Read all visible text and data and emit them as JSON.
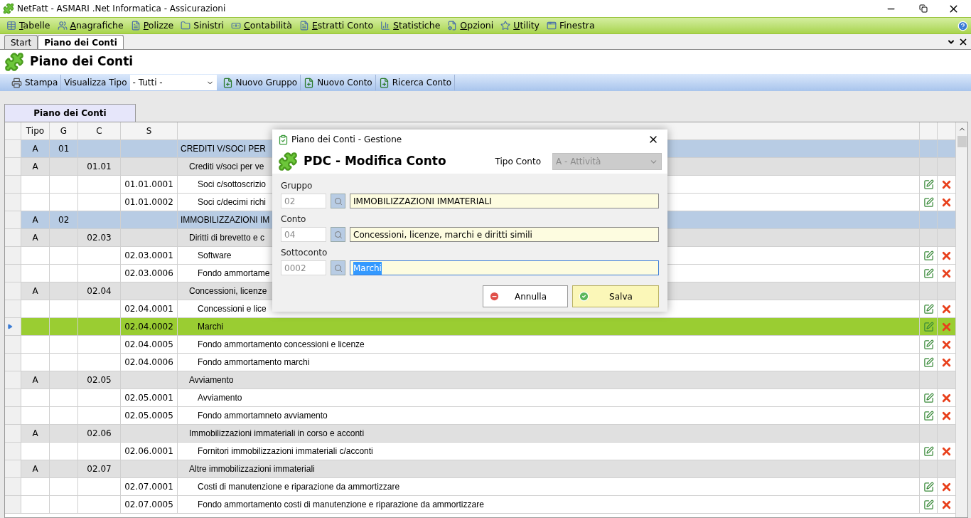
{
  "window": {
    "title": "NetFatt - ASMARI .Net Informatica - Assicurazioni"
  },
  "menu": [
    {
      "label": "Tabelle",
      "accel": true
    },
    {
      "label": "Anagrafiche",
      "accel": true
    },
    {
      "label": "Polizze",
      "accel": true
    },
    {
      "label": "Sinistri",
      "accel": false
    },
    {
      "label": "Contabilità",
      "accel": true
    },
    {
      "label": "Estratti Conto",
      "accel": true
    },
    {
      "label": "Statistiche",
      "accel": true
    },
    {
      "label": "Opzioni",
      "accel": true
    },
    {
      "label": "Utility",
      "accel": true
    },
    {
      "label": "Finestra",
      "accel": false
    }
  ],
  "doc_tabs": [
    {
      "label": "Start",
      "selected": false
    },
    {
      "label": "Piano dei Conti",
      "selected": true
    }
  ],
  "page_title": "Piano dei Conti",
  "toolbar": [
    {
      "kind": "button",
      "label": "Stampa"
    },
    {
      "kind": "label",
      "label": "Visualizza Tipo"
    },
    {
      "kind": "select",
      "label": "- Tutti -"
    },
    {
      "kind": "button",
      "label": "Nuovo Gruppo"
    },
    {
      "kind": "button",
      "label": "Nuovo Conto"
    },
    {
      "kind": "button",
      "label": "Ricerca Conto"
    }
  ],
  "grid": {
    "tab": "Piano dei Conti",
    "columns": [
      "Tipo",
      "G",
      "C",
      "S"
    ],
    "rows": [
      {
        "kind": "group",
        "tipo": "A",
        "g": "01",
        "c": "",
        "s": "",
        "description": "CREDITI V/SOCI PER",
        "selected": false
      },
      {
        "kind": "conto",
        "tipo": "A",
        "g": "",
        "c": "01.01",
        "s": "",
        "description": "Crediti v/soci per ve",
        "selected": false
      },
      {
        "kind": "sub",
        "tipo": "",
        "g": "",
        "c": "",
        "s": "01.01.0001",
        "description": "Soci c/sottoscrizio",
        "selected": false
      },
      {
        "kind": "sub",
        "tipo": "",
        "g": "",
        "c": "",
        "s": "01.01.0002",
        "description": "Soci c/decimi richi",
        "selected": false
      },
      {
        "kind": "group",
        "tipo": "A",
        "g": "02",
        "c": "",
        "s": "",
        "description": "IMMOBILIZZAZIONI IM",
        "selected": false
      },
      {
        "kind": "conto",
        "tipo": "A",
        "g": "",
        "c": "02.03",
        "s": "",
        "description": "Diritti di brevetto e c",
        "selected": false
      },
      {
        "kind": "sub",
        "tipo": "",
        "g": "",
        "c": "",
        "s": "02.03.0001",
        "description": "Software",
        "selected": false
      },
      {
        "kind": "sub",
        "tipo": "",
        "g": "",
        "c": "",
        "s": "02.03.0006",
        "description": "Fondo ammortame",
        "selected": false
      },
      {
        "kind": "conto",
        "tipo": "A",
        "g": "",
        "c": "02.04",
        "s": "",
        "description": "Concessioni, licenze",
        "selected": false
      },
      {
        "kind": "sub",
        "tipo": "",
        "g": "",
        "c": "",
        "s": "02.04.0001",
        "description": "Concessioni e lice",
        "selected": false
      },
      {
        "kind": "sub",
        "tipo": "",
        "g": "",
        "c": "",
        "s": "02.04.0002",
        "description": "Marchi",
        "selected": true
      },
      {
        "kind": "sub",
        "tipo": "",
        "g": "",
        "c": "",
        "s": "02.04.0005",
        "description": "Fondo ammortamento concessioni e licenze",
        "selected": false
      },
      {
        "kind": "sub",
        "tipo": "",
        "g": "",
        "c": "",
        "s": "02.04.0006",
        "description": "Fondo ammortamento marchi",
        "selected": false
      },
      {
        "kind": "conto",
        "tipo": "A",
        "g": "",
        "c": "02.05",
        "s": "",
        "description": "Avviamento",
        "selected": false
      },
      {
        "kind": "sub",
        "tipo": "",
        "g": "",
        "c": "",
        "s": "02.05.0001",
        "description": "Avviamento",
        "selected": false
      },
      {
        "kind": "sub",
        "tipo": "",
        "g": "",
        "c": "",
        "s": "02.05.0005",
        "description": "Fondo ammortamneto avviamento",
        "selected": false
      },
      {
        "kind": "conto",
        "tipo": "A",
        "g": "",
        "c": "02.06",
        "s": "",
        "description": "Immobilizzazioni immateriali in corso e acconti",
        "selected": false
      },
      {
        "kind": "sub",
        "tipo": "",
        "g": "",
        "c": "",
        "s": "02.06.0001",
        "description": "Fornitori immobilizzazioni immateriali c/acconti",
        "selected": false
      },
      {
        "kind": "conto",
        "tipo": "A",
        "g": "",
        "c": "02.07",
        "s": "",
        "description": "Altre immobilizzazioni immateriali",
        "selected": false
      },
      {
        "kind": "sub",
        "tipo": "",
        "g": "",
        "c": "",
        "s": "02.07.0001",
        "description": "Costi di manutenzione e riparazione da ammortizzare",
        "selected": false
      },
      {
        "kind": "sub",
        "tipo": "",
        "g": "",
        "c": "",
        "s": "02.07.0005",
        "description": "Fondo ammortamento costi di manutenzione e riparazione da ammortizzare",
        "selected": false
      }
    ]
  },
  "dialog": {
    "title": "Piano dei Conti - Gestione",
    "heading": "PDC - Modifica Conto",
    "tipo_label": "Tipo Conto",
    "tipo_value": "A - Attività",
    "tipo_disabled": true,
    "fields": [
      {
        "label": "Gruppo",
        "code": "02",
        "value": "IMMOBILIZZAZIONI IMMATERIALI",
        "focused": false
      },
      {
        "label": "Conto",
        "code": "04",
        "value": "Concessioni, licenze, marchi e diritti simili",
        "focused": false
      },
      {
        "label": "Sottoconto",
        "code": "0002",
        "value": "Marchi",
        "focused": true
      }
    ],
    "buttons": [
      {
        "kind": "cancel",
        "label": "Annulla"
      },
      {
        "kind": "save",
        "label": "Salva"
      }
    ]
  }
}
